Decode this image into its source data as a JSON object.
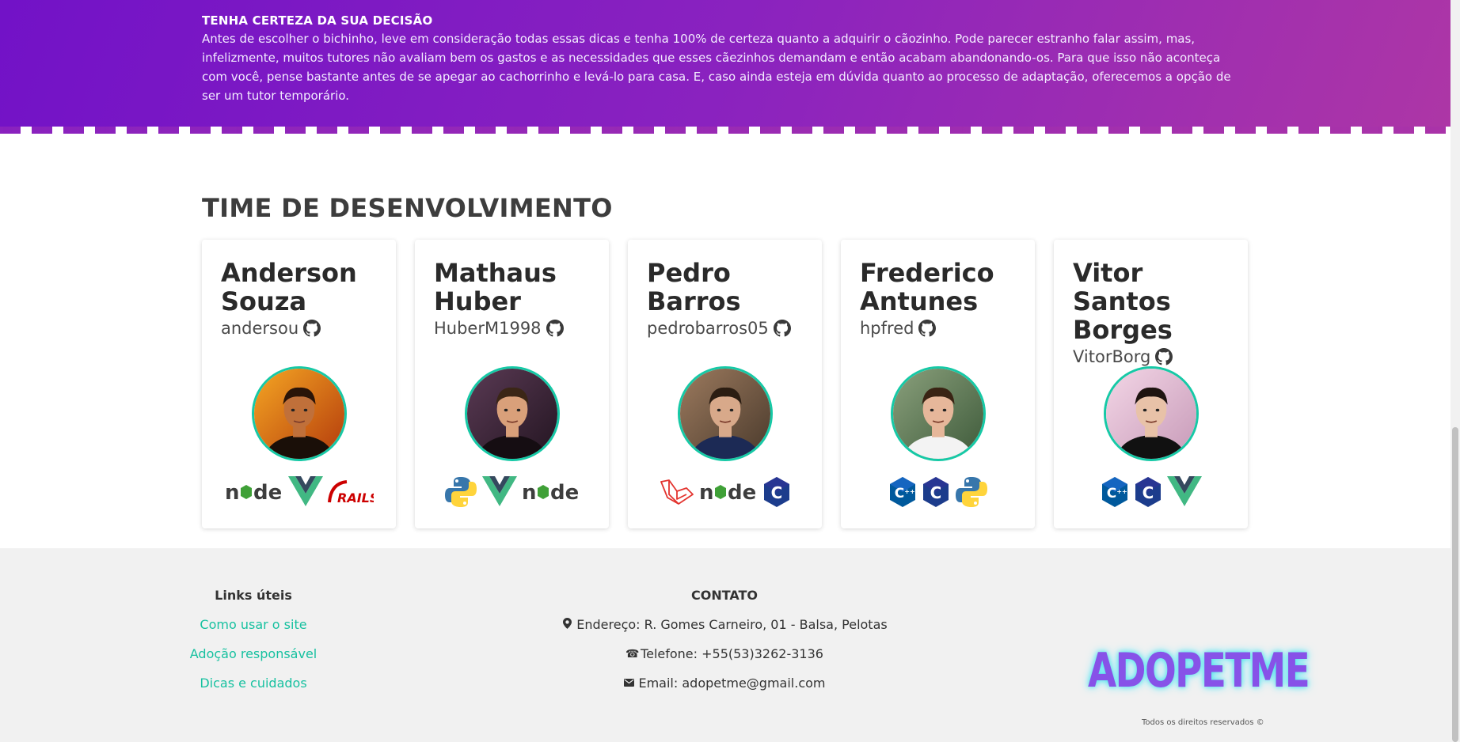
{
  "banner": {
    "title": "TENHA CERTEZA DA SUA DECISÃO",
    "text": "Antes de escolher o bichinho, leve em consideração todas essas dicas e tenha 100% de certeza quanto a adquirir o cãozinho. Pode parecer estranho falar assim, mas, infelizmente, muitos tutores não avaliam bem os gastos e as necessidades que esses cãezinhos demandam e então acabam abandonando-os. Para que isso não aconteça com você, pense bastante antes de se apegar ao cachorrinho e levá-lo para casa. E, caso ainda esteja em dúvida quanto ao processo de adaptação, oferecemos a opção de ser um tutor temporário."
  },
  "team": {
    "title": "TIME DE DESENVOLVIMENTO",
    "members": [
      {
        "name": "Anderson Souza",
        "github": "andersou",
        "techs": [
          "nodejs",
          "vuejs",
          "rails"
        ]
      },
      {
        "name": "Mathaus Huber",
        "github": "HuberM1998",
        "techs": [
          "python",
          "vuejs",
          "nodejs"
        ]
      },
      {
        "name": "Pedro Barros",
        "github": "pedrobarros05",
        "techs": [
          "laravel",
          "nodejs",
          "c"
        ]
      },
      {
        "name": "Frederico Antunes",
        "github": "hpfred",
        "techs": [
          "cpp",
          "c",
          "python"
        ]
      },
      {
        "name": "Vitor Santos Borges",
        "github": "VitorBorg",
        "techs": [
          "cpp",
          "c",
          "vuejs"
        ]
      }
    ]
  },
  "footer": {
    "links_title": "Links úteis",
    "links": [
      "Como usar o site",
      "Adoção responsável",
      "Dicas e cuidados"
    ],
    "contact_title": "CONTATO",
    "address": "Endereço: R. Gomes Carneiro, 01 - Balsa, Pelotas",
    "phone": "Telefone: +55(53)3262-3136",
    "email": "Email: adopetme@gmail.com",
    "brand": "ADOPETME",
    "rights": "Todos os direitos reservados ©"
  },
  "colors": {
    "accent": "#17c1a0",
    "banner_start": "#7212c7",
    "banner_end": "#ad36a6",
    "brand": "#8752e8"
  }
}
